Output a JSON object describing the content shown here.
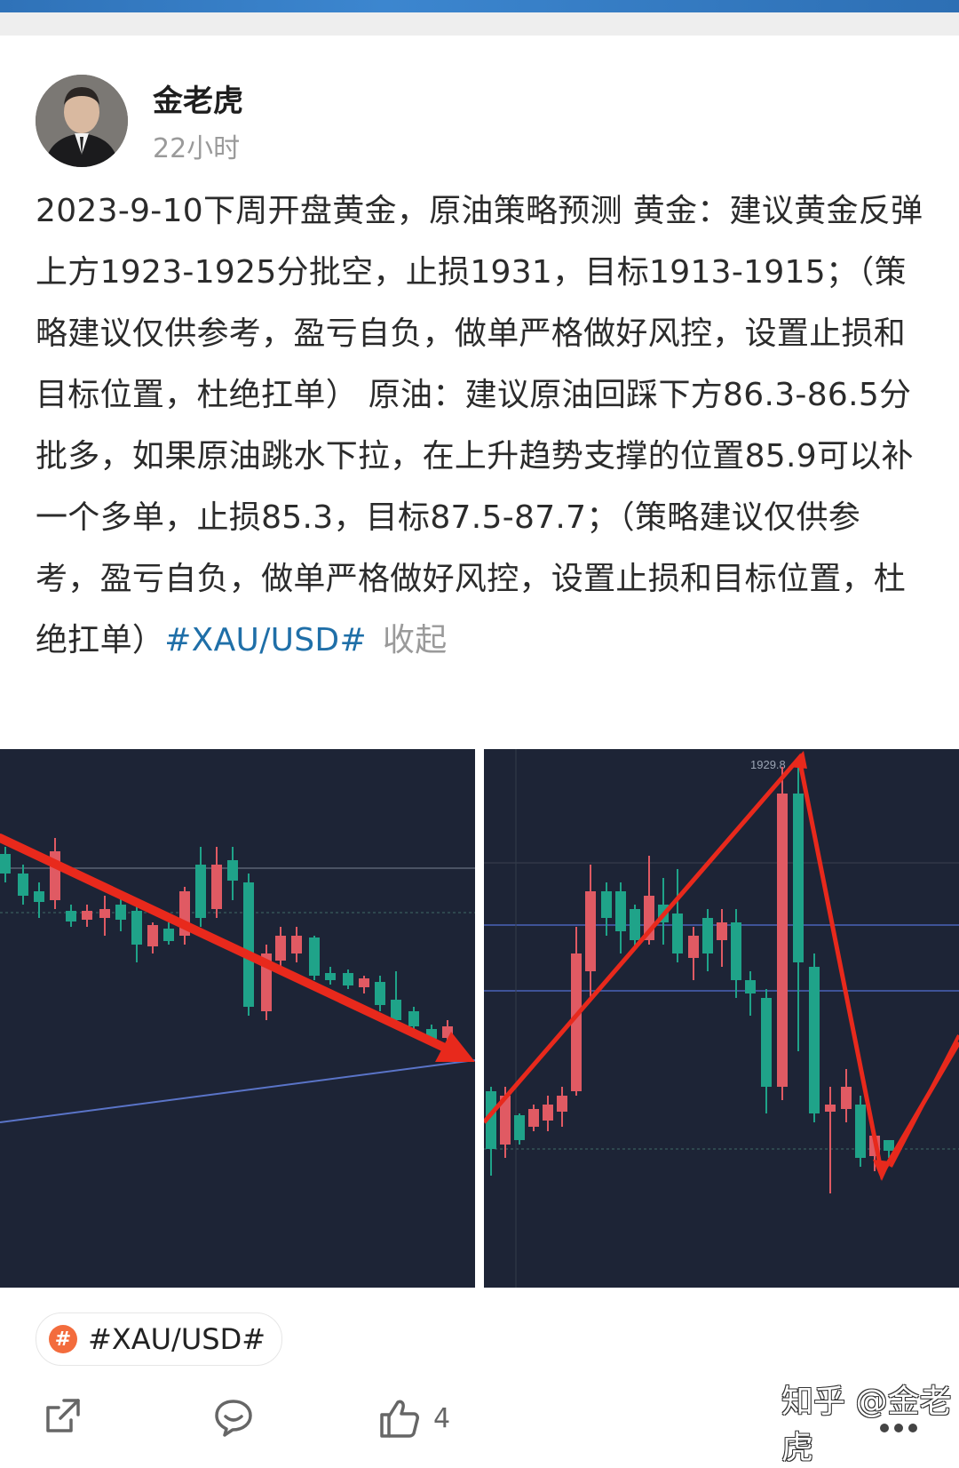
{
  "post": {
    "author_name": "金老虎",
    "time": "22小时",
    "body_text": "2023-9-10下周开盘黄金，原油策略预测 黄金：建议黄金反弹上方1923-1925分批空，止损1931，目标1913-1915；（策略建议仅供参考，盈亏自负，做单严格做好风控，设置止损和目标位置，杜绝扛单） 原油：建议原油回踩下方86.3-86.5分批多，如果原油跳水下拉，在上升趋势支撑的位置85.9可以补一个多单，止损85.3，目标87.5-87.7；（策略建议仅供参考，盈亏自负，做单严格做好风控，设置止损和目标位置，杜绝扛单）",
    "topic_inline": "#XAU/USD#",
    "collapse_label": "收起"
  },
  "images": {
    "right_chart_price_label": "1929.8"
  },
  "topic_pill": {
    "badge": "#",
    "label": "#XAU/USD#"
  },
  "actions": {
    "share_icon": "share-icon",
    "comment_icon": "comment-icon",
    "like_icon": "thumbs-up-icon",
    "like_count": "4",
    "more_icon": "more-icon"
  },
  "watermark": "知乎 @金老虎",
  "colors": {
    "link": "#1f6fa8",
    "chart_bg": "#1d2436",
    "bull": "#1fa389",
    "bear": "#e05a63",
    "arrow": "#e8291c",
    "badge": "#f36c3d"
  }
}
